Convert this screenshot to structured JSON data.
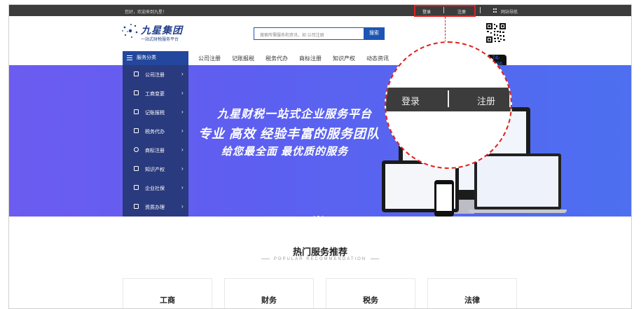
{
  "topbar": {
    "welcome": "您好，欢迎来到九星！",
    "login": "登录",
    "register": "注册",
    "sitemap": "网站导航"
  },
  "header": {
    "logo_name": "九星集团",
    "logo_slogan": "一站式财税服务平台",
    "search_placeholder": "搜索所需服务和资讯，如  公司注册",
    "search_button": "搜索"
  },
  "nav": {
    "category_label": "服务分类",
    "items": [
      "公司注册",
      "记账报税",
      "税务代办",
      "商标注册",
      "知识产权",
      "动态资讯"
    ],
    "phone": "4-74-12366"
  },
  "sidemenu": {
    "items": [
      {
        "label": "公司注册",
        "icon": "document-icon"
      },
      {
        "label": "工商变更",
        "icon": "file-edit-icon"
      },
      {
        "label": "记账报税",
        "icon": "ledger-icon"
      },
      {
        "label": "税务代办",
        "icon": "building-icon"
      },
      {
        "label": "商标注册",
        "icon": "registered-icon"
      },
      {
        "label": "知识产权",
        "icon": "layers-icon"
      },
      {
        "label": "企业社保",
        "icon": "shield-icon"
      },
      {
        "label": "资质办理",
        "icon": "certificate-icon"
      }
    ]
  },
  "banner": {
    "line1": "九星财税一站式企业服务平台",
    "line2": "专业   高效   经验丰富的服务团队",
    "line3": "给您最全面  最优质的服务"
  },
  "zoom": {
    "login": "登录",
    "register": "注册"
  },
  "section": {
    "title": "热门服务推荐",
    "subtitle": "POPULAR RECOMMENDATION",
    "cards": [
      "工商",
      "财务",
      "税务",
      "法律"
    ]
  },
  "colors": {
    "brand_blue": "#1e55b5",
    "nav_dark": "#2a3a7e",
    "topbar": "#3c3c3c",
    "highlight_red": "#e02020",
    "banner_start": "#6c5cf0",
    "banner_end": "#4d6ff0"
  }
}
